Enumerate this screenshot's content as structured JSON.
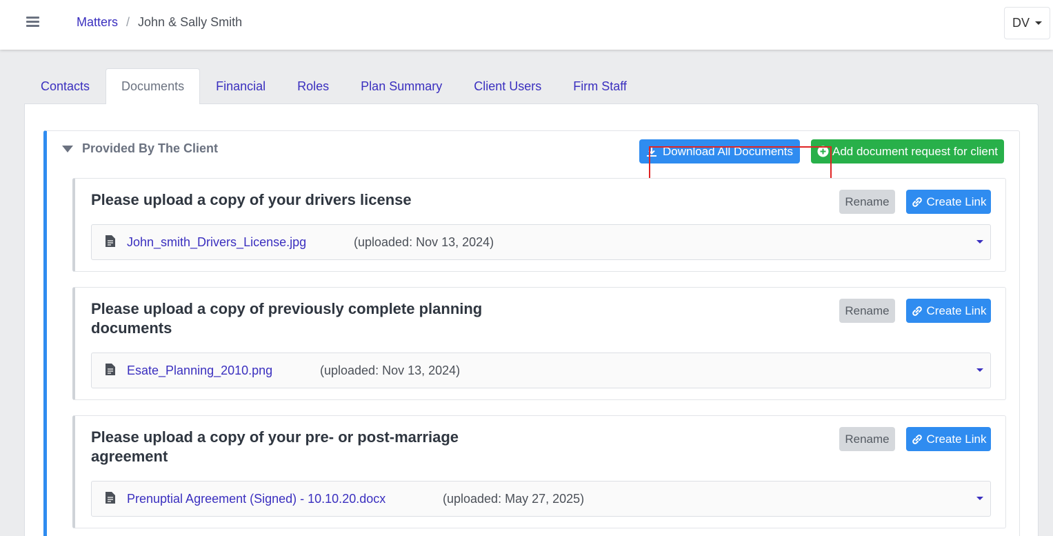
{
  "breadcrumb": {
    "parent": "Matters",
    "current": "John & Sally Smith"
  },
  "user_menu": {
    "initials": "DV"
  },
  "tabs": [
    {
      "label": "Contacts",
      "active": false
    },
    {
      "label": "Documents",
      "active": true
    },
    {
      "label": "Financial",
      "active": false
    },
    {
      "label": "Roles",
      "active": false
    },
    {
      "label": "Plan Summary",
      "active": false
    },
    {
      "label": "Client Users",
      "active": false
    },
    {
      "label": "Firm Staff",
      "active": false
    }
  ],
  "section": {
    "title": "Provided By The Client",
    "download_all_label": "Download All Documents",
    "add_request_label": "Add document request for client"
  },
  "requests": [
    {
      "title": "Please upload a copy of your drivers license",
      "rename_label": "Rename",
      "create_link_label": "Create Link",
      "file": {
        "name": "John_smith_Drivers_License.jpg",
        "uploaded": "(uploaded: Nov 13, 2024)"
      }
    },
    {
      "title": "Please upload a copy of previously complete planning documents",
      "rename_label": "Rename",
      "create_link_label": "Create Link",
      "file": {
        "name": "Esate_Planning_2010.png",
        "uploaded": "(uploaded: Nov 13, 2024)"
      }
    },
    {
      "title": "Please upload a copy of your pre- or post-marriage agreement",
      "rename_label": "Rename",
      "create_link_label": "Create Link",
      "file": {
        "name": "Prenuptial Agreement (Signed) - 10.10.20.docx",
        "uploaded": "(uploaded: May 27, 2025)"
      }
    }
  ],
  "colors": {
    "accent_blue": "#2f8cf0",
    "link": "#3a2fbf",
    "success_green": "#28b04a",
    "highlight_red": "#e02424"
  },
  "icons": {
    "menu": "hamburger-icon",
    "download": "download-icon",
    "add": "plus-circle-icon",
    "link": "link-icon",
    "file": "file-icon",
    "collapse": "triangle-down-icon"
  }
}
